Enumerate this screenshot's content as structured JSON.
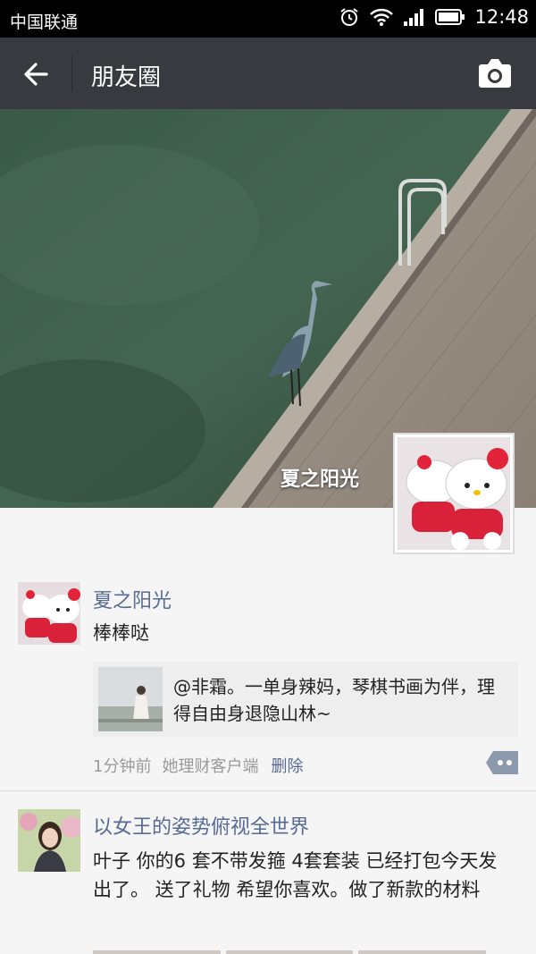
{
  "status_bar": {
    "carrier": "中国联通",
    "time": "12:48",
    "icons": [
      "alarm-icon",
      "wifi-icon",
      "signal-icon",
      "battery-icon"
    ]
  },
  "title_bar": {
    "title": "朋友圈",
    "back_icon": "arrow-left-icon",
    "camera_icon": "camera-icon",
    "background": "#393a3f"
  },
  "cover": {
    "user_name": "夏之阳光"
  },
  "posts": [
    {
      "user_name": "夏之阳光",
      "text": "棒棒哒",
      "shared": {
        "text": "@非霜。一单身辣妈，琴棋书画为伴，理得自由身退隐山林~"
      },
      "time": "1分钟前",
      "source": "她理财客户端",
      "delete_label": "删除"
    },
    {
      "user_name": "以女王的姿势俯视全世界",
      "text": "叶子 你的6 套不带发箍 4套套装 已经打包今天发出了。 送了礼物 希望你喜欢。做了新款的材料"
    }
  ],
  "colors": {
    "link": "#576b95",
    "meta": "#9a9a9a",
    "page_bg": "#f5f5f5"
  }
}
